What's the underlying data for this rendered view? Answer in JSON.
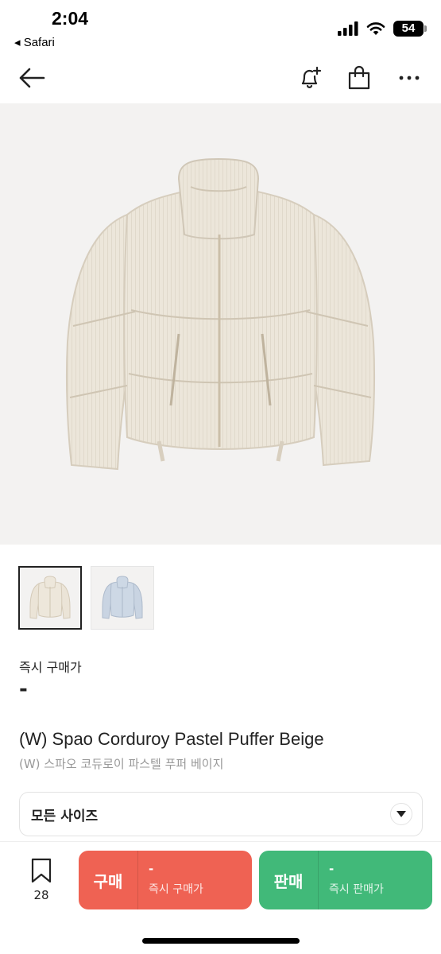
{
  "status_bar": {
    "time": "2:04",
    "back_app": "◂ Safari",
    "battery": "54"
  },
  "nav": {
    "icons": [
      "back-arrow-icon",
      "bell-plus-icon",
      "shopping-bag-icon",
      "more-icon"
    ]
  },
  "product": {
    "main_image": "beige-corduroy-puffer-jacket",
    "thumbnails": [
      "beige-puffer-thumbnail",
      "light-blue-puffer-thumbnail"
    ],
    "price_label": "즉시 구매가",
    "price_value": "-",
    "title_en": "(W) Spao Corduroy Pastel Puffer Beige",
    "title_ko": "(W) 스파오 코듀로이 파스텔 푸퍼 베이지"
  },
  "size_selector": {
    "label": "모든 사이즈"
  },
  "bottom_bar": {
    "wish_count": "28",
    "buy": {
      "label": "구매",
      "price": "-",
      "sub": "즉시 구매가",
      "color": "#ef6253"
    },
    "sell": {
      "label": "판매",
      "price": "-",
      "sub": "즉시 판매가",
      "color": "#41b979"
    }
  }
}
